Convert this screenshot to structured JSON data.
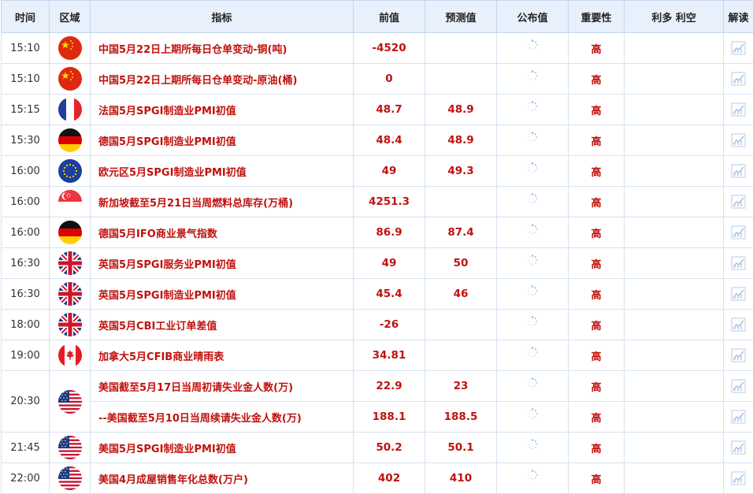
{
  "headers": [
    "时间",
    "区域",
    "指标",
    "前值",
    "预测值",
    "公布值",
    "重要性",
    "利多 利空",
    "解读"
  ],
  "rows": [
    {
      "time": "15:10",
      "flag": "china-flag-icon",
      "indicator": "中国5月22日上期所每日仓单变动-铜(吨)",
      "prev": "-4520",
      "fore": "",
      "imp": "高"
    },
    {
      "time": "15:10",
      "flag": "china-flag-icon",
      "indicator": "中国5月22日上期所每日仓单变动-原油(桶)",
      "prev": "0",
      "fore": "",
      "imp": "高"
    },
    {
      "time": "15:15",
      "flag": "france-flag-icon",
      "indicator": "法国5月SPGI制造业PMI初值",
      "prev": "48.7",
      "fore": "48.9",
      "imp": "高"
    },
    {
      "time": "15:30",
      "flag": "germany-flag-icon",
      "indicator": "德国5月SPGI制造业PMI初值",
      "prev": "48.4",
      "fore": "48.9",
      "imp": "高"
    },
    {
      "time": "16:00",
      "flag": "eu-flag-icon",
      "indicator": "欧元区5月SPGI制造业PMI初值",
      "prev": "49",
      "fore": "49.3",
      "imp": "高"
    },
    {
      "time": "16:00",
      "flag": "singapore-flag-icon",
      "indicator": "新加坡截至5月21日当周燃料总库存(万桶)",
      "prev": "4251.3",
      "fore": "",
      "imp": "高"
    },
    {
      "time": "16:00",
      "flag": "germany-flag-icon",
      "indicator": "德国5月IFO商业景气指数",
      "prev": "86.9",
      "fore": "87.4",
      "imp": "高"
    },
    {
      "time": "16:30",
      "flag": "uk-flag-icon",
      "indicator": "英国5月SPGI服务业PMI初值",
      "prev": "49",
      "fore": "50",
      "imp": "高"
    },
    {
      "time": "16:30",
      "flag": "uk-flag-icon",
      "indicator": "英国5月SPGI制造业PMI初值",
      "prev": "45.4",
      "fore": "46",
      "imp": "高"
    },
    {
      "time": "18:00",
      "flag": "uk-flag-icon",
      "indicator": "英国5月CBI工业订单差值",
      "prev": "-26",
      "fore": "",
      "imp": "高"
    },
    {
      "time": "19:00",
      "flag": "canada-flag-icon",
      "indicator": "加拿大5月CFIB商业晴雨表",
      "prev": "34.81",
      "fore": "",
      "imp": "高"
    },
    {
      "time": "20:30",
      "flag": "usa-flag-icon",
      "indicator": "美国截至5月17日当周初请失业金人数(万)",
      "prev": "22.9",
      "fore": "23",
      "imp": "高",
      "rowspan": 2
    },
    {
      "time": "",
      "flag": "",
      "indicator": "--美国截至5月10日当周续请失业金人数(万)",
      "prev": "188.1",
      "fore": "188.5",
      "imp": "高",
      "merged": true
    },
    {
      "time": "21:45",
      "flag": "usa-flag-icon",
      "indicator": "美国5月SPGI制造业PMI初值",
      "prev": "50.2",
      "fore": "50.1",
      "imp": "高"
    },
    {
      "time": "22:00",
      "flag": "usa-flag-icon",
      "indicator": "美国4月成屋销售年化总数(万户)",
      "prev": "402",
      "fore": "410",
      "imp": "高"
    }
  ]
}
